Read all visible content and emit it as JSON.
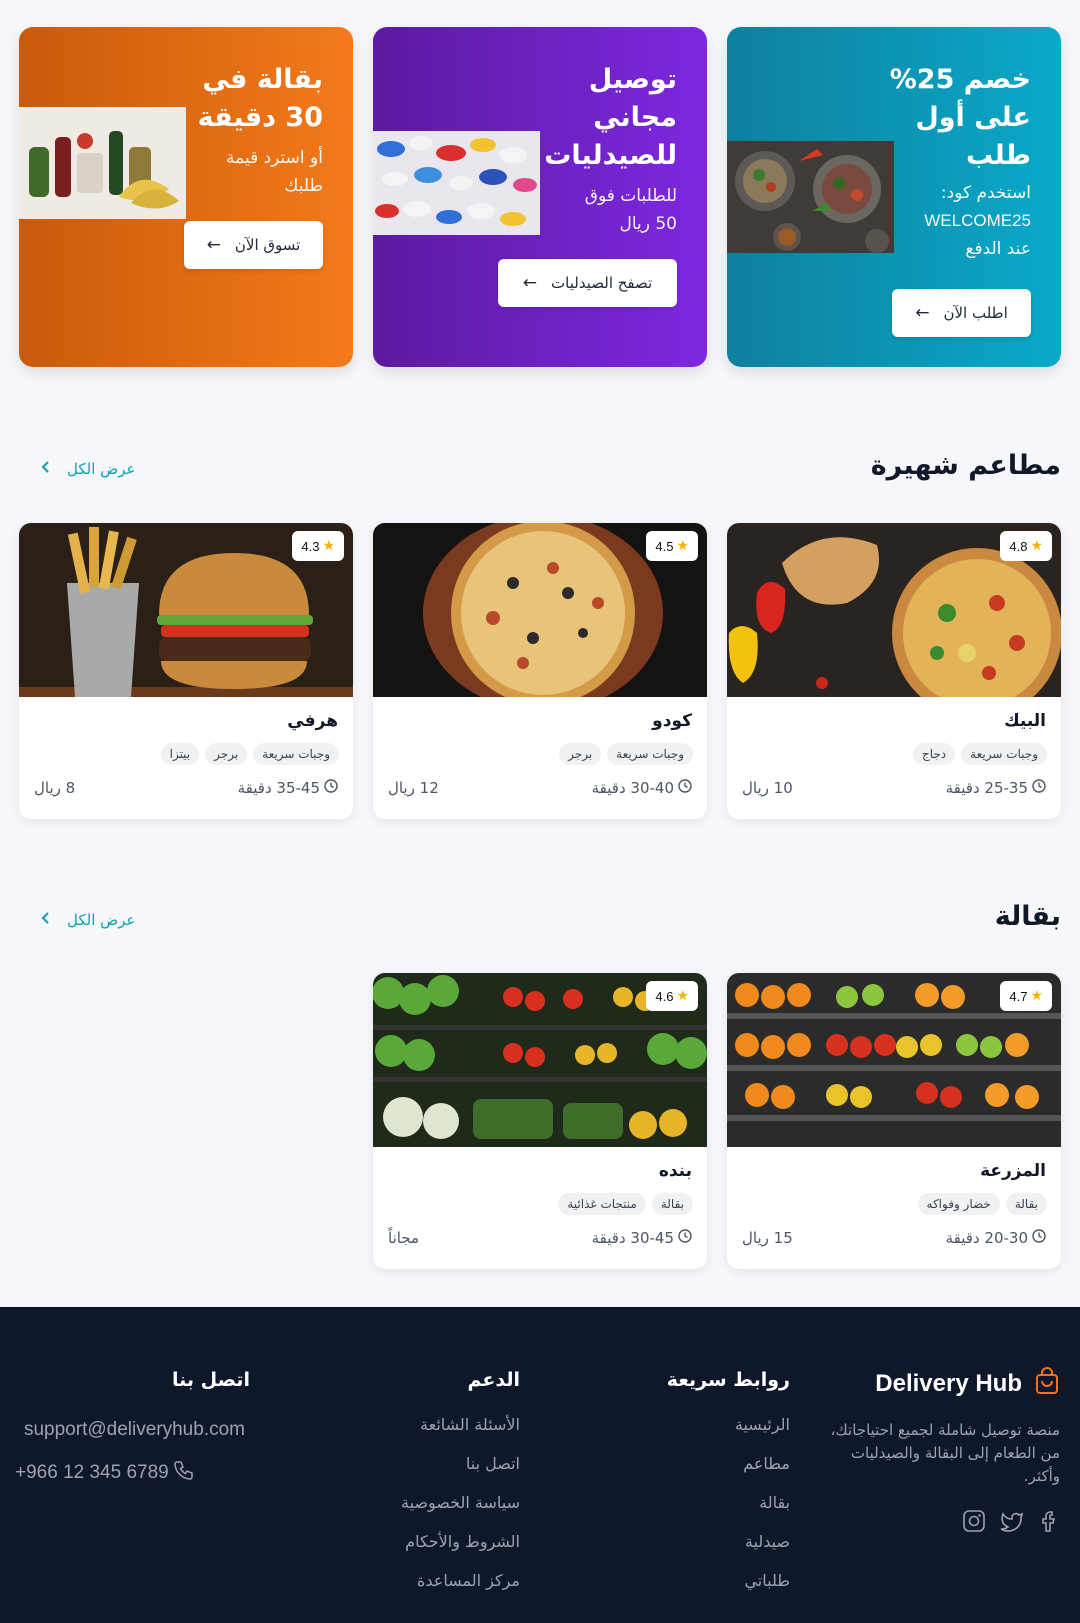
{
  "promos": [
    {
      "title": "خصم 25% على أول طلب",
      "text_line1": "استخدم كود:",
      "text_code": "WELCOME25",
      "text_line3": "عند الدفع",
      "button": "اطلب الآن",
      "color": "#0aa9c9"
    },
    {
      "title": "توصيل مجاني للصيدليات",
      "text_line1": "للطلبات فوق",
      "text_code": "50 ريال",
      "button": "تصفح الصيدليات",
      "color": "#7d28e0"
    },
    {
      "title": "بقالة في 30 دقيقة",
      "text_line1": "أو استرد قيمة",
      "text_line2": "طلبك",
      "button": "تسوق الآن",
      "color": "#f47a1a"
    }
  ],
  "popular": {
    "title": "مطاعم شهيرة",
    "view_all": "عرض الكل",
    "items": [
      {
        "name": "البيك",
        "rating": "4.8",
        "tags": [
          "وجبات سريعة",
          "دجاج"
        ],
        "time": "25-35 دقيقة",
        "fee": "10 ريال"
      },
      {
        "name": "كودو",
        "rating": "4.5",
        "tags": [
          "وجبات سريعة",
          "برجر"
        ],
        "time": "30-40 دقيقة",
        "fee": "12 ريال"
      },
      {
        "name": "هرفي",
        "rating": "4.3",
        "tags": [
          "وجبات سريعة",
          "برجر",
          "بيتزا"
        ],
        "time": "35-45 دقيقة",
        "fee": "8 ريال"
      }
    ]
  },
  "grocery": {
    "title": "بقالة",
    "view_all": "عرض الكل",
    "items": [
      {
        "name": "المزرعة",
        "rating": "4.7",
        "tags": [
          "بقالة",
          "خضار وفواكه"
        ],
        "time": "20-30 دقيقة",
        "fee": "15 ريال"
      },
      {
        "name": "بنده",
        "rating": "4.6",
        "tags": [
          "بقالة",
          "منتجات غذائية"
        ],
        "time": "30-45 دقيقة",
        "fee": "مجاناً"
      }
    ]
  },
  "footer": {
    "brand": "Delivery Hub",
    "description": "منصة توصيل شاملة لجميع احتياجاتك، من الطعام إلى البقالة والصيدليات وأكثر.",
    "quick_links_title": "روابط سريعة",
    "quick_links": [
      "الرئيسية",
      "مطاعم",
      "بقالة",
      "صيدلية",
      "طلباتي"
    ],
    "support_title": "الدعم",
    "support_links": [
      "الأسئلة الشائعة",
      "اتصل بنا",
      "سياسة الخصوصية",
      "الشروط والأحكام",
      "مركز المساعدة"
    ],
    "contact_title": "اتصل بنا",
    "email": "support@deliveryhub.com",
    "phone": "+966 12 345 6789",
    "social_icons": [
      "facebook-icon",
      "twitter-icon",
      "instagram-icon"
    ]
  }
}
